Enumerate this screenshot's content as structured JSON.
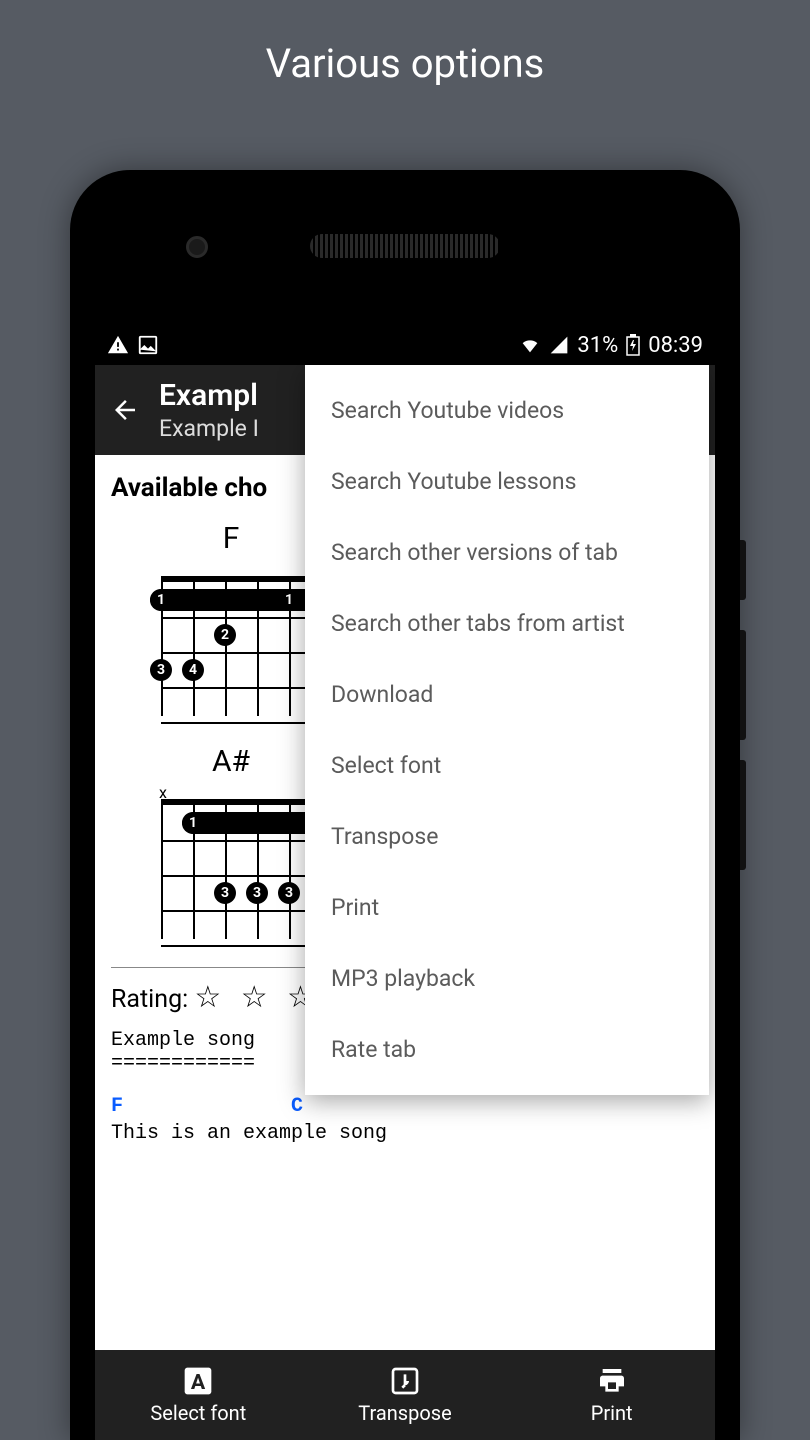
{
  "promo_title": "Various options",
  "status": {
    "battery_label": "31%",
    "time": "08:39"
  },
  "appbar": {
    "title": "Exampl",
    "subtitle_visible": "Example I"
  },
  "section_title_visible": "Available cho",
  "chords": [
    {
      "name": "F",
      "muted_prefix": "",
      "dots": [
        {
          "string": 0,
          "fret": 1,
          "finger": "1"
        },
        {
          "string": 4,
          "fret": 1,
          "finger": "1"
        },
        {
          "string": 5,
          "fret": 1,
          "finger": "1"
        },
        {
          "string": 2,
          "fret": 2,
          "finger": "2"
        },
        {
          "string": 0,
          "fret": 3,
          "finger": "3"
        },
        {
          "string": 1,
          "fret": 3,
          "finger": "4"
        }
      ],
      "barre": {
        "fret": 1,
        "from": 0,
        "to": 5
      }
    },
    {
      "name": "A#",
      "muted_prefix": "x",
      "dots": [
        {
          "string": 1,
          "fret": 1,
          "finger": "1"
        },
        {
          "string": 5,
          "fret": 1,
          "finger": "1"
        },
        {
          "string": 2,
          "fret": 3,
          "finger": "3"
        },
        {
          "string": 3,
          "fret": 3,
          "finger": "3"
        },
        {
          "string": 4,
          "fret": 3,
          "finger": "3"
        }
      ],
      "barre": {
        "fret": 1,
        "from": 1,
        "to": 5
      }
    }
  ],
  "rating": {
    "label": "Rating:",
    "stars_visible": "☆ ☆ ☆"
  },
  "tab_text": {
    "song_title_line": "Example song",
    "divider_line": "============",
    "chord_line": {
      "c1": "F",
      "c2": "C",
      "spacing_between": 14
    },
    "lyric_line": "This is an example song"
  },
  "bottombar": {
    "items": [
      {
        "id": "font",
        "label": "Select font"
      },
      {
        "id": "transpose",
        "label": "Transpose"
      },
      {
        "id": "print",
        "label": "Print"
      }
    ]
  },
  "menu": {
    "items": [
      "Search Youtube videos",
      "Search Youtube lessons",
      "Search other versions of tab",
      "Search other tabs from artist",
      "Download",
      "Select font",
      "Transpose",
      "Print",
      "MP3 playback",
      "Rate tab"
    ]
  }
}
